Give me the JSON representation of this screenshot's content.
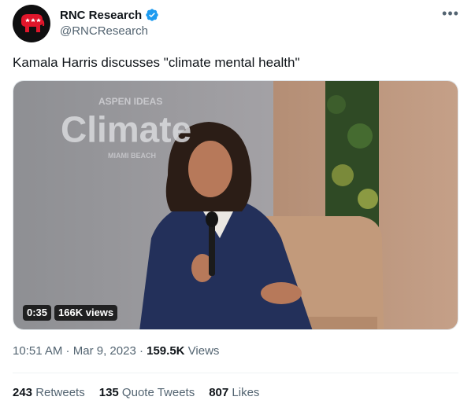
{
  "account": {
    "display_name": "RNC Research",
    "handle": "@RNCResearch",
    "verified": true,
    "avatar_icon": "gop-elephant-icon"
  },
  "more_label": "•••",
  "tweet": {
    "text": "Kamala Harris discusses \"climate mental health\""
  },
  "media": {
    "type": "video",
    "backdrop_word": "Climate",
    "backdrop_small_top": "ASPEN IDEAS",
    "backdrop_small_bottom": "MIAMI BEACH",
    "duration": "0:35",
    "views_badge": "166K views"
  },
  "meta": {
    "time": "10:51 AM",
    "separator1": " · ",
    "date": "Mar 9, 2023",
    "separator2": " · ",
    "views_count": "159.5K",
    "views_label": " Views"
  },
  "stats": {
    "retweets_count": "243",
    "retweets_label": " Retweets",
    "quotes_count": "135",
    "quotes_label": " Quote Tweets",
    "likes_count": "807",
    "likes_label": " Likes"
  },
  "colors": {
    "verified_blue": "#1d9bf0",
    "avatar_red": "#e0162b",
    "secondary_text": "#536471"
  }
}
